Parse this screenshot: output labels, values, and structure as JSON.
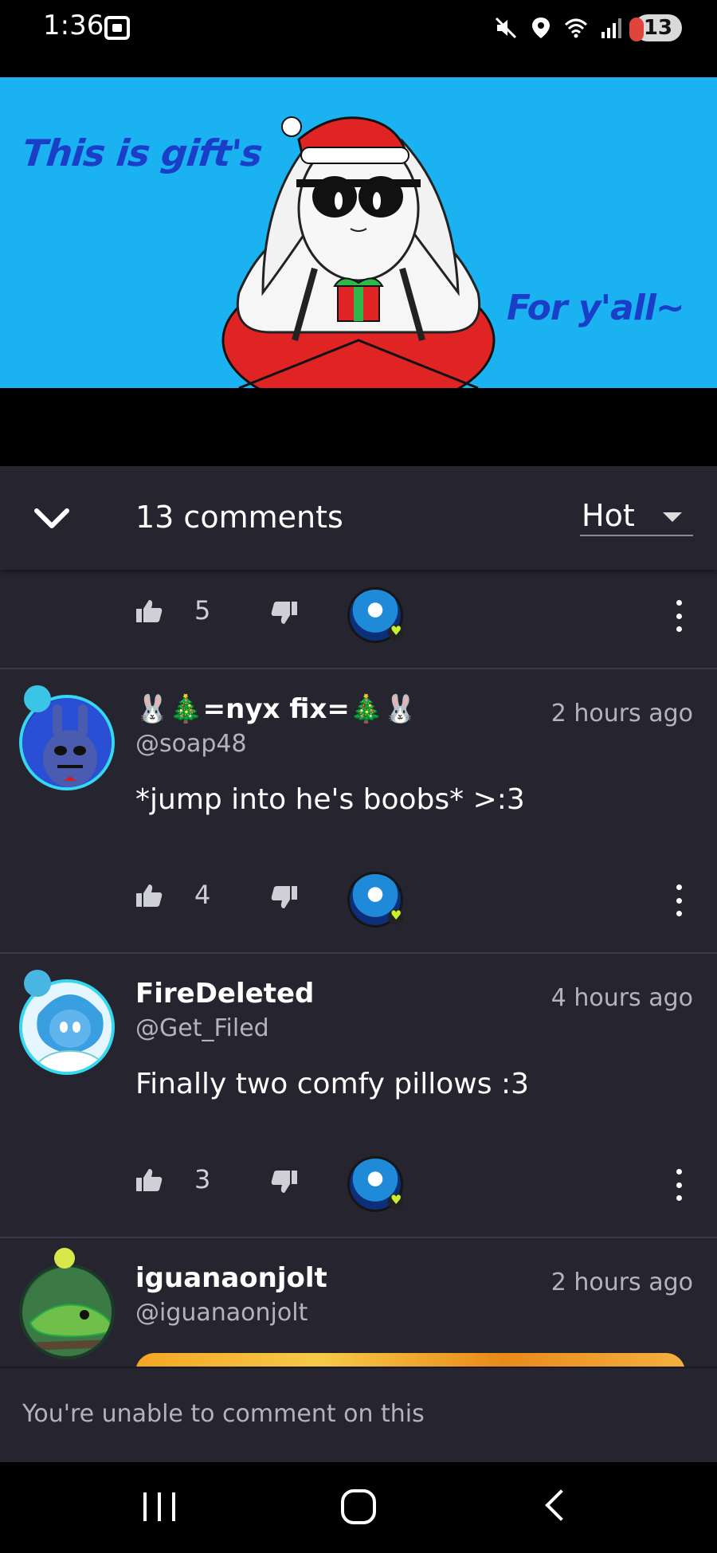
{
  "status_bar": {
    "time": "1:36",
    "notification_count": "13",
    "icons": [
      "screenshot-icon",
      "mute-icon",
      "location-icon",
      "wifi-icon",
      "signal-icon"
    ]
  },
  "banner": {
    "text_left": "This is gift's",
    "text_right": "For y'all~",
    "background_color": "#1ab2f0",
    "text_color": "#1a3ec8"
  },
  "comments_header": {
    "count_label": "13 comments",
    "sort_label": "Hot"
  },
  "top_partial": {
    "likes": "5"
  },
  "comments": [
    {
      "username": "🐰🎄=nyx fix=🎄🐰",
      "handle": "@soap48",
      "time": "2 hours ago",
      "text": "*jump into he's boobs* >:3",
      "likes": "4"
    },
    {
      "username": "FireDeleted",
      "handle": "@Get_Filed",
      "time": "4 hours ago",
      "text": "Finally two comfy pillows :3",
      "likes": "3"
    },
    {
      "username": "iguanaonjolt",
      "handle": "@iguanaonjolt",
      "time": "2 hours ago"
    }
  ],
  "bottom_bar": {
    "message": "You're unable to comment on this"
  },
  "colors": {
    "panel_bg": "#26252f",
    "avatar_ring": "#35d8f0",
    "heart_accent": "#c8f02e"
  }
}
